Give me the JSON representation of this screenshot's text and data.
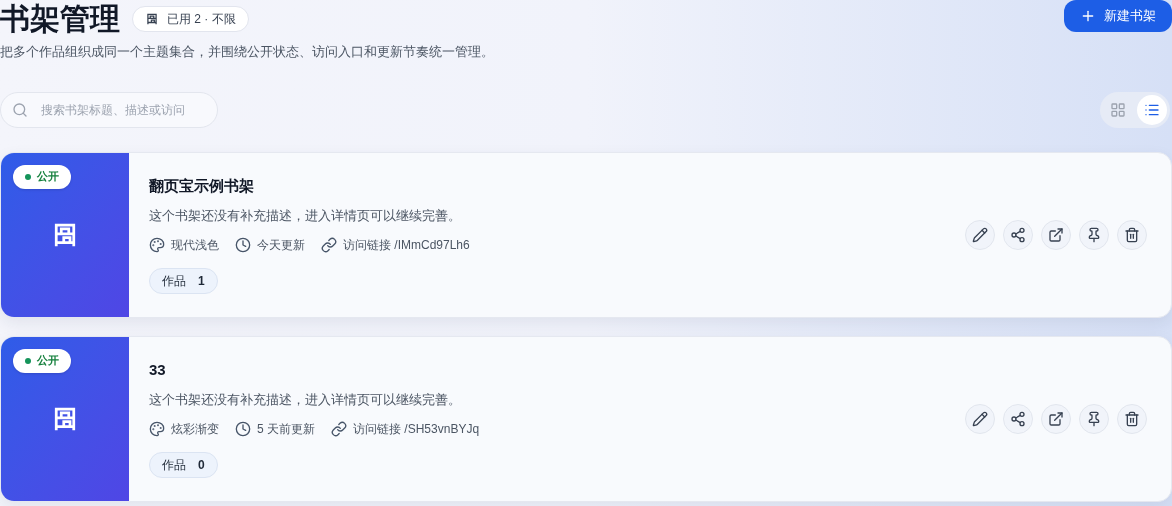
{
  "header": {
    "title": "书架管理",
    "usage": "已用 2 · 不限",
    "subtitle": "把多个作品组织成同一个主题集合，并围绕公开状态、访问入口和更新节奏统一管理。",
    "new_button": "新建书架"
  },
  "search": {
    "placeholder": "搜索书架标题、描述或访问"
  },
  "view_toggle": [
    {
      "kind": "grid",
      "selected": false
    },
    {
      "kind": "list",
      "selected": true
    }
  ],
  "shelves": [
    {
      "status": "公开",
      "title": "翻页宝示例书架",
      "description": "这个书架还没有补充描述，进入详情页可以继续完善。",
      "theme": "现代浅色",
      "updated": "今天更新",
      "link": "访问链接 /IMmCd97Lh6",
      "works_label": "作品",
      "works_count": "1"
    },
    {
      "status": "公开",
      "title": "33",
      "description": "这个书架还没有补充描述，进入详情页可以继续完善。",
      "theme": "炫彩渐变",
      "updated": "5 天前更新",
      "link": "访问链接 /SH53vnBYJq",
      "works_label": "作品",
      "works_count": "0"
    }
  ]
}
